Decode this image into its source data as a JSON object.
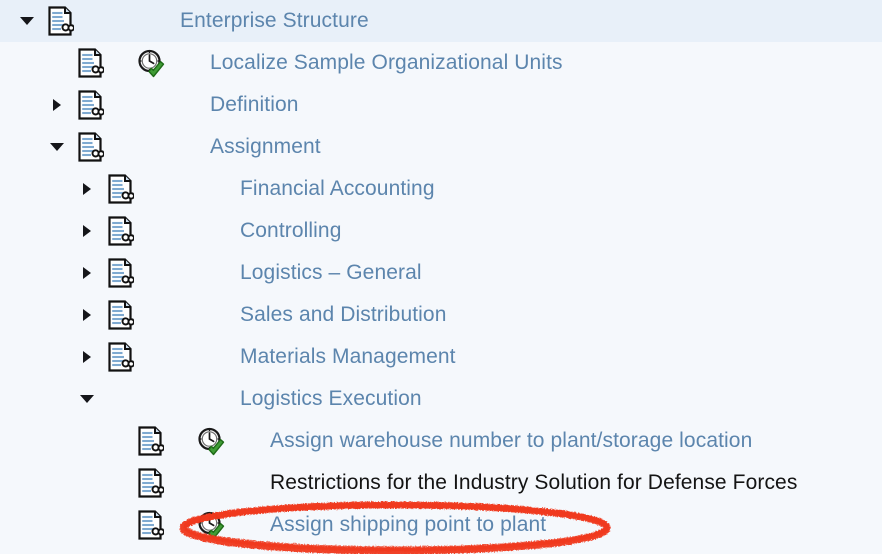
{
  "theme": {
    "background": "#f5f8fc",
    "selected_row_background": "#e8f0f9",
    "link_text_color": "#5c85ad",
    "plain_text_color": "#141414",
    "annotation_color": "#f0381c",
    "icon_outline_color": "#1a1a1a",
    "icon_fill_color": "#cfe0f0",
    "check_color": "#3f9c35"
  },
  "tree": {
    "rows": [
      {
        "label": "Enterprise Structure",
        "depth": 0,
        "expander": "down",
        "has_doc_icon": true,
        "has_clock_icon": false,
        "selected": true,
        "text_style": "link",
        "annotated": false
      },
      {
        "label": "Localize Sample Organizational Units",
        "depth": 1,
        "expander": "none",
        "has_doc_icon": true,
        "has_clock_icon": true,
        "selected": false,
        "text_style": "link",
        "annotated": false
      },
      {
        "label": "Definition",
        "depth": 1,
        "expander": "right",
        "has_doc_icon": true,
        "has_clock_icon": false,
        "selected": false,
        "text_style": "link",
        "annotated": false
      },
      {
        "label": "Assignment",
        "depth": 1,
        "expander": "down",
        "has_doc_icon": true,
        "has_clock_icon": false,
        "selected": false,
        "text_style": "link",
        "annotated": false
      },
      {
        "label": "Financial Accounting",
        "depth": 2,
        "expander": "right",
        "has_doc_icon": true,
        "has_clock_icon": false,
        "selected": false,
        "text_style": "link",
        "annotated": false
      },
      {
        "label": "Controlling",
        "depth": 2,
        "expander": "right",
        "has_doc_icon": true,
        "has_clock_icon": false,
        "selected": false,
        "text_style": "link",
        "annotated": false
      },
      {
        "label": "Logistics – General",
        "depth": 2,
        "expander": "right",
        "has_doc_icon": true,
        "has_clock_icon": false,
        "selected": false,
        "text_style": "link",
        "annotated": false
      },
      {
        "label": "Sales and Distribution",
        "depth": 2,
        "expander": "right",
        "has_doc_icon": true,
        "has_clock_icon": false,
        "selected": false,
        "text_style": "link",
        "annotated": false
      },
      {
        "label": "Materials Management",
        "depth": 2,
        "expander": "right",
        "has_doc_icon": true,
        "has_clock_icon": false,
        "selected": false,
        "text_style": "link",
        "annotated": false
      },
      {
        "label": "Logistics Execution",
        "depth": 2,
        "expander": "down",
        "has_doc_icon": false,
        "has_clock_icon": false,
        "selected": false,
        "text_style": "link",
        "annotated": false
      },
      {
        "label": "Assign warehouse number to plant/storage location",
        "depth": 3,
        "expander": "none",
        "has_doc_icon": true,
        "has_clock_icon": true,
        "selected": false,
        "text_style": "link",
        "annotated": false
      },
      {
        "label": "Restrictions for the Industry Solution for Defense Forces",
        "depth": 3,
        "expander": "none",
        "has_doc_icon": true,
        "has_clock_icon": false,
        "selected": false,
        "text_style": "plain",
        "annotated": false
      },
      {
        "label": "Assign shipping point to plant",
        "depth": 3,
        "expander": "none",
        "has_doc_icon": true,
        "has_clock_icon": true,
        "selected": false,
        "text_style": "link",
        "annotated": true
      }
    ]
  },
  "annotation": {
    "shape": "ellipse",
    "target_row_label": "Assign shipping point to plant",
    "color": "#f0381c"
  }
}
